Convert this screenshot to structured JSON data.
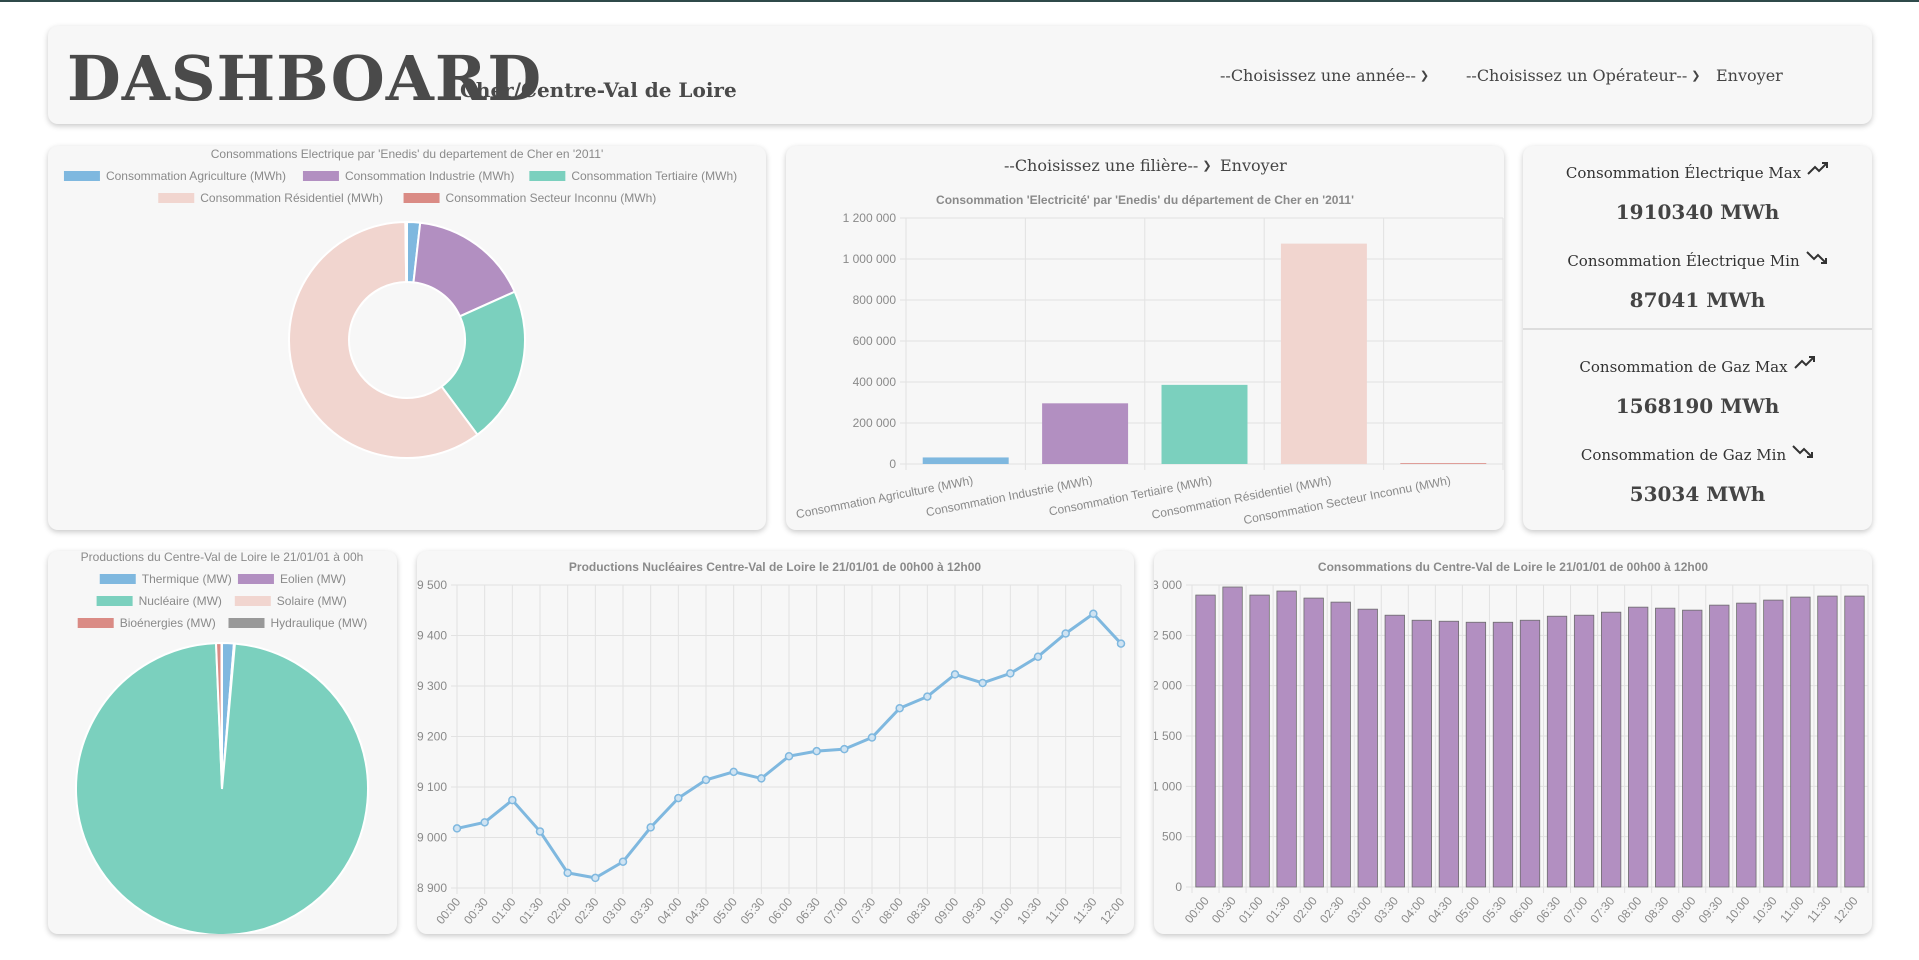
{
  "header": {
    "title": "DASHBOARD",
    "subtitle": "Cher/Centre-Val de Loire",
    "year_select": "--Choisissez une année--",
    "operator_select": "--Choisissez un Opérateur--",
    "send_label": "Envoyer"
  },
  "bar_panel": {
    "filiere_select": "--Choisissez une filière--",
    "send_label": "Envoyer"
  },
  "stats": {
    "elec_max_label": "Consommation Électrique Max",
    "elec_max_value": "1910340 MWh",
    "elec_min_label": "Consommation Électrique Min",
    "elec_min_value": "87041 MWh",
    "gaz_max_label": "Consommation de Gaz Max",
    "gaz_max_value": "1568190 MWh",
    "gaz_min_label": "Consommation de Gaz Min",
    "gaz_min_value": "53034 MWh",
    "trend_up_icon": "trending-up-icon",
    "trend_down_icon": "trending-down-icon"
  },
  "chart_data": [
    {
      "type": "pie",
      "title": "Consommations Electrique par 'Enedis' du departement de Cher en '2011'",
      "donut": true,
      "legend": "top",
      "labels": [
        "Consommation Agriculture (MWh)",
        "Consommation Industrie (MWh)",
        "Consommation Tertiaire  (MWh)",
        "Consommation Résidentiel  (MWh)",
        "Consommation Secteur Inconnu (MWh)"
      ],
      "values": [
        32000,
        296000,
        386000,
        1075000,
        4000
      ],
      "colors": [
        "#7fb8df",
        "#b28fc1",
        "#7bd0be",
        "#f1d5cf",
        "#da8b85"
      ]
    },
    {
      "type": "bar",
      "title": "Consommation 'Electricité' par 'Enedis' du département de Cher en '2011'",
      "categories": [
        "Consommation Agriculture (MWh)",
        "Consommation Industrie (MWh)",
        "Consommation Tertiaire  (MWh)",
        "Consommation Résidentiel  (MWh)",
        "Consommation Secteur Inconnu (MWh)"
      ],
      "values": [
        32000,
        296000,
        386000,
        1075000,
        4000
      ],
      "colors": [
        "#7fb8df",
        "#b28fc1",
        "#7bd0be",
        "#f1d5cf",
        "#da8b85"
      ],
      "ylim": [
        0,
        1200000
      ],
      "yticks": [
        0,
        200000,
        400000,
        600000,
        800000,
        1000000,
        1200000
      ],
      "ytick_labels": [
        "0",
        "200 000",
        "400 000",
        "600 000",
        "800 000",
        "1 000 000",
        "1 200 000"
      ],
      "grid": true
    },
    {
      "type": "pie",
      "title": "Productions du Centre-Val de Loire le 21/01/01 à 00h",
      "legend": "top",
      "labels": [
        "Thermique (MW)",
        "Eolien (MW)",
        "Nucléaire (MW)",
        "Solaire (MW)",
        "Bioénergies (MW)",
        "Hydraulique (MW)"
      ],
      "values": [
        120,
        10,
        9020,
        0,
        55,
        5
      ],
      "colors": [
        "#7fb8df",
        "#b28fc1",
        "#7bd0be",
        "#f1d5cf",
        "#da8b85",
        "#999999"
      ]
    },
    {
      "type": "line",
      "title": "Productions Nucléaires Centre-Val de Loire le 21/01/01 de 00h00 à 12h00",
      "x": [
        "00:00",
        "00:30",
        "01:00",
        "01:30",
        "02:00",
        "02:30",
        "03:00",
        "03:30",
        "04:00",
        "04:30",
        "05:00",
        "05:30",
        "06:00",
        "06:30",
        "07:00",
        "07:30",
        "08:00",
        "08:30",
        "09:00",
        "09:30",
        "10:00",
        "10:30",
        "11:00",
        "11:30",
        "12:00"
      ],
      "values": [
        9018,
        9030,
        9074,
        9012,
        8930,
        8920,
        8952,
        9020,
        9078,
        9114,
        9130,
        9117,
        9161,
        9171,
        9175,
        9198,
        9256,
        9279,
        9323,
        9306,
        9325,
        9358,
        9404,
        9443,
        9384
      ],
      "ylim": [
        8900,
        9500
      ],
      "yticks": [
        8900,
        9000,
        9100,
        9200,
        9300,
        9400,
        9500
      ],
      "ytick_labels": [
        "8 900",
        "9 000",
        "9 100",
        "9 200",
        "9 300",
        "9 400",
        "9 500"
      ],
      "color": "#7fb8df",
      "grid": true
    },
    {
      "type": "bar",
      "title": "Consommations du Centre-Val de Loire le 21/01/01 de 00h00 à 12h00",
      "categories": [
        "00:00",
        "00:30",
        "01:00",
        "01:30",
        "02:00",
        "02:30",
        "03:00",
        "03:30",
        "04:00",
        "04:30",
        "05:00",
        "05:30",
        "06:00",
        "06:30",
        "07:00",
        "07:30",
        "08:00",
        "08:30",
        "09:00",
        "09:30",
        "10:00",
        "10:30",
        "11:00",
        "11:30",
        "12:00"
      ],
      "values": [
        2900,
        2980,
        2900,
        2940,
        2870,
        2830,
        2760,
        2700,
        2650,
        2640,
        2630,
        2630,
        2650,
        2690,
        2700,
        2730,
        2780,
        2770,
        2750,
        2800,
        2820,
        2850,
        2880,
        2890,
        2890
      ],
      "ylim": [
        0,
        3000
      ],
      "yticks": [
        0,
        500,
        1000,
        1500,
        2000,
        2500,
        3000
      ],
      "ytick_labels": [
        "0",
        "500",
        "1 000",
        "1 500",
        "2 000",
        "2 500",
        "3 000"
      ],
      "color": "#b28fc1",
      "grid": true
    }
  ]
}
